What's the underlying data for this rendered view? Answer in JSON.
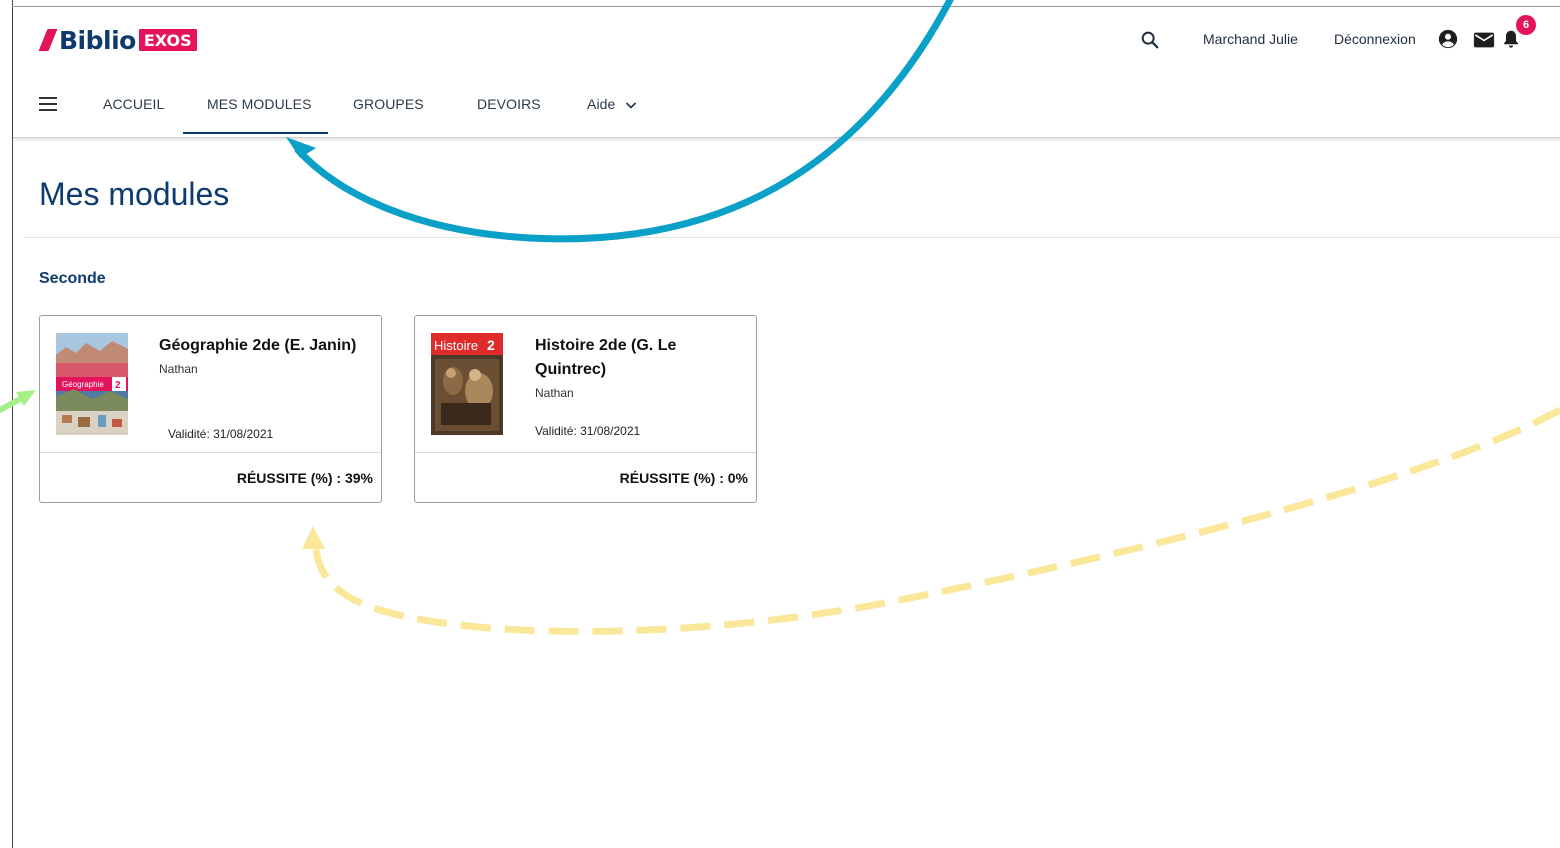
{
  "header": {
    "logo_text": "Biblio",
    "logo_badge": "EXOS",
    "user_name": "Marchand Julie",
    "logout_label": "Déconnexion",
    "notification_count": "6"
  },
  "nav": {
    "items": [
      {
        "label": "ACCUEIL"
      },
      {
        "label": "MES MODULES",
        "active": true
      },
      {
        "label": "GROUPES"
      },
      {
        "label": "DEVOIRS"
      },
      {
        "label": "Aide"
      }
    ]
  },
  "page": {
    "title": "Mes modules",
    "section": "Seconde"
  },
  "modules": [
    {
      "title": "Géographie 2de (E. Janin)",
      "publisher": "Nathan",
      "cover_label": "Géographie 2de",
      "validity": "Validité: 31/08/2021",
      "score_label": "RÉUSSITE (%) : 39%"
    },
    {
      "title": "Histoire 2de (G. Le Quintrec)",
      "publisher": "Nathan",
      "cover_label": "Histoire 2de",
      "validity": "Validité: 31/08/2021",
      "score_label": "RÉUSSITE (%) : 0%"
    }
  ],
  "colors": {
    "brand_navy": "#0d3b6f",
    "brand_pink": "#e4145c",
    "arrow_blue": "#0aa0c8",
    "arrow_yellow": "#fbe79a",
    "arrow_green": "#a6f08a"
  }
}
